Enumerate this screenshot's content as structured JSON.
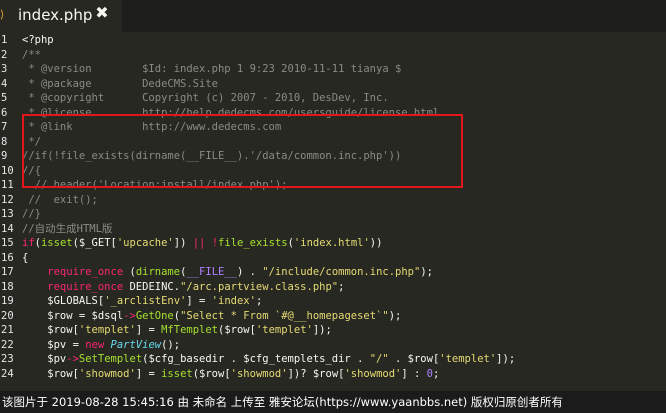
{
  "tab": {
    "title": "index.php",
    "close_glyph": "✖",
    "file_icon": "document-icon"
  },
  "colors": {
    "background": "#272822",
    "comment": "#8b8b82",
    "keyword": "#f92672",
    "string": "#e6db74",
    "function": "#a6e22e",
    "highlight_border": "#e2161b"
  },
  "line_numbers": [
    "1",
    "2",
    "3",
    "4",
    "5",
    "6",
    "7",
    "8",
    "9",
    "10",
    "11",
    "12",
    "13",
    "14",
    "15",
    "16",
    "17",
    "18",
    "19",
    "20",
    "21",
    "22",
    "23",
    "24"
  ],
  "code": {
    "l1": "<?php",
    "l2": "/**",
    "l3": " * @version        $Id: index.php 1 9:23 2010-11-11 tianya $",
    "l4": " * @package        DedeCMS.Site",
    "l5": " * @copyright      Copyright (c) 2007 - 2010, DesDev, Inc.",
    "l6": " * @license        http://help.dedecms.com/usersguide/license.html",
    "l7": " * @link           http://www.dedecms.com",
    "l8": " */",
    "l9": "//if(!file_exists(dirname(__FILE__).'/data/common.inc.php'))",
    "l10": "//{",
    "l11": "  // header('Location:install/index.php');",
    "l12": " //  exit();",
    "l13": "//}",
    "l14": "//自动生成HTML版",
    "l15": {
      "a": "if",
      "b": "(",
      "c": "isset",
      "d": "($_GET[",
      "e": "'upcache'",
      "f": "]) ",
      "g": "||",
      "h": " ",
      "i": "!",
      "j": "file_exists",
      "k": "(",
      "l": "'index.html'",
      "m": "))"
    },
    "l16": "{",
    "l17": {
      "a": "    require_once",
      "b": " (",
      "c": "dirname",
      "d": "(",
      "e": "__FILE__",
      "f": ") . ",
      "g": "\"/include/common.inc.php\"",
      "h": ");"
    },
    "l18": {
      "a": "    require_once",
      "b": " DEDEINC.",
      "c": "\"/arc.partview.class.php\"",
      "d": ";"
    },
    "l19": {
      "a": "    $GLOBALS[",
      "b": "'_arclistEnv'",
      "c": "] = ",
      "d": "'index'",
      "e": ";"
    },
    "l20": {
      "a": "    $row = $dsql",
      "b": "->",
      "c": "GetOne",
      "d": "(",
      "e": "\"Select * From `#@__homepageset`\"",
      "f": ");"
    },
    "l21": {
      "a": "    $row[",
      "b": "'templet'",
      "c": "] = ",
      "d": "MfTemplet",
      "e": "($row[",
      "f": "'templet'",
      "g": "]);"
    },
    "l22": {
      "a": "    $pv = ",
      "b": "new",
      "c": " ",
      "d": "PartView",
      "e": "();"
    },
    "l23": {
      "a": "    $pv",
      "b": "->",
      "c": "SetTemplet",
      "d": "($cfg_basedir . $cfg_templets_dir . ",
      "e": "\"/\"",
      "f": " . $row[",
      "g": "'templet'",
      "h": "]);"
    },
    "l24": {
      "a": "    $row[",
      "b": "'showmod'",
      "c": "] = ",
      "d": "isset",
      "e": "($row[",
      "f": "'showmod'",
      "g": "])? $row[",
      "h": "'showmod'",
      "i": "] : ",
      "j": "0",
      "k": ";"
    }
  },
  "caption": "该图片于 2019-08-28 15:45:16 由 未命名 上传至 雅安论坛(https://www.yaanbbs.net) 版权归原创者所有"
}
